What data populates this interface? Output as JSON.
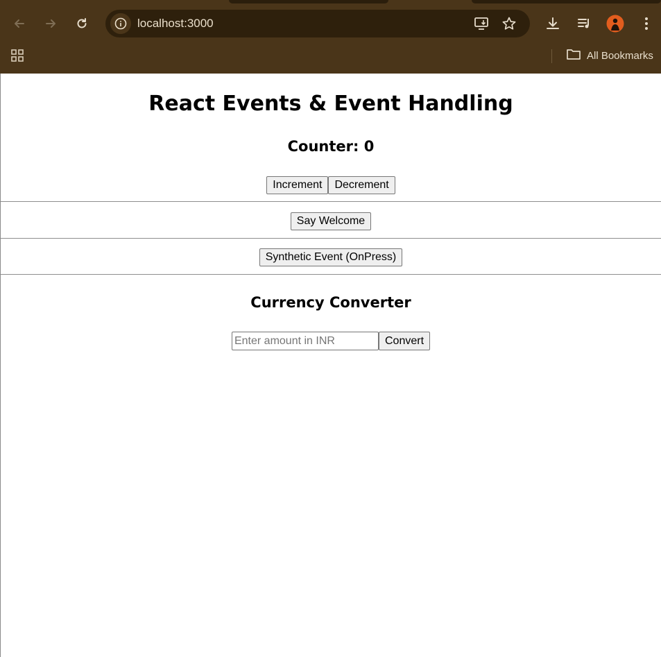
{
  "browser": {
    "url": "localhost:3000",
    "bookmarks_label": "All Bookmarks",
    "theme_color": "#4a3519"
  },
  "icons": {
    "back": "arrow-left",
    "forward": "arrow-right",
    "reload": "reload",
    "site_info": "info",
    "install": "monitor-download",
    "bookmark": "star",
    "downloads": "download",
    "media": "playlist",
    "profile": "avatar",
    "menu": "kebab",
    "apps": "grid",
    "folder": "folder"
  },
  "page": {
    "title": "React Events & Event Handling",
    "counter_label": "Counter: 0",
    "increment_label": "Increment",
    "decrement_label": "Decrement",
    "welcome_label": "Say Welcome",
    "synthetic_label": "Synthetic Event (OnPress)",
    "converter_title": "Currency Converter",
    "amount_placeholder": "Enter amount in INR",
    "amount_value": "",
    "convert_label": "Convert"
  }
}
